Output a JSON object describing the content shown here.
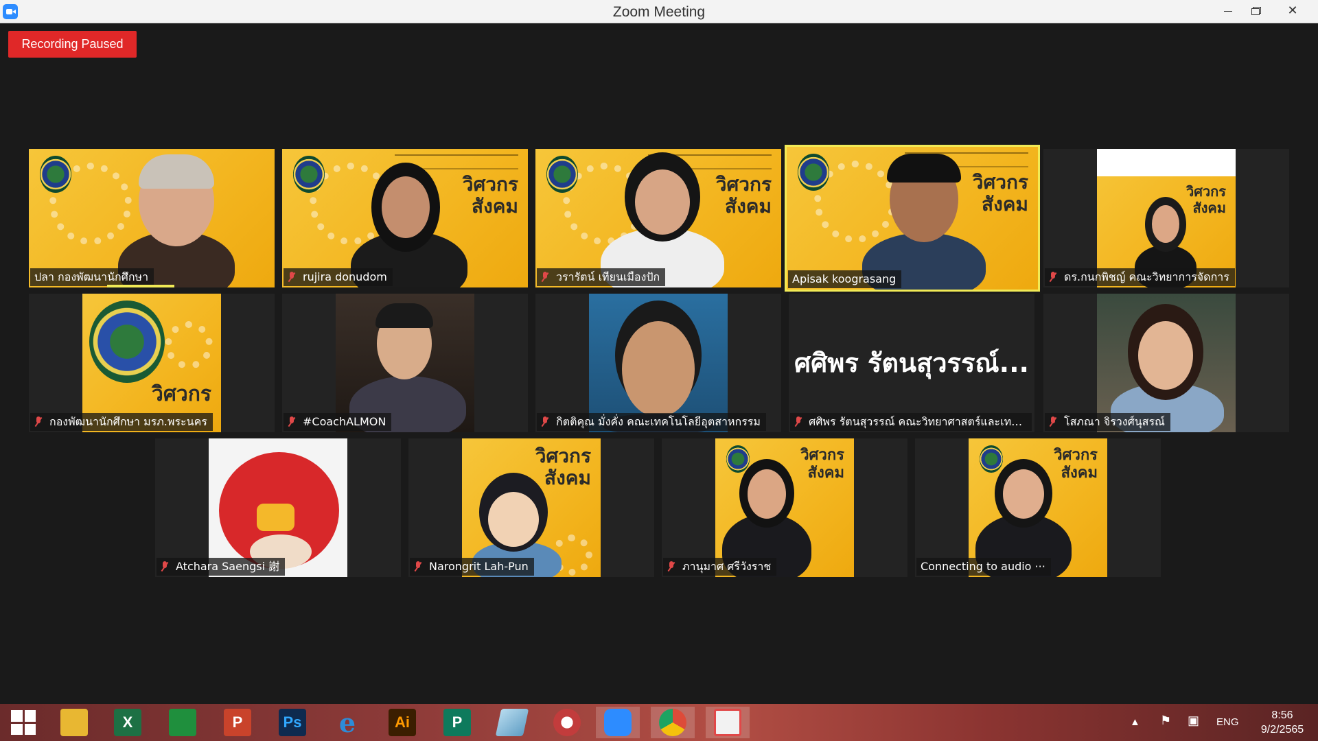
{
  "window": {
    "title": "Zoom Meeting",
    "minimize_symbol": "",
    "maximize_symbol": "",
    "close_symbol": "✕"
  },
  "recording_status": "Recording Paused",
  "banner_text": "วิศวกร\nสังคม",
  "participants": [
    {
      "name": "ปลา กองพัฒนานักศึกษา",
      "muted": false,
      "active": false,
      "speaking": true,
      "video": "camera"
    },
    {
      "name": "rujira donudom",
      "muted": true,
      "active": false,
      "speaking": false,
      "video": "camera"
    },
    {
      "name": "วรารัตน์ เทียนเมืองปัก",
      "muted": true,
      "active": false,
      "speaking": false,
      "video": "camera"
    },
    {
      "name": "Apisak koograsang",
      "muted": false,
      "active": true,
      "speaking": false,
      "video": "camera"
    },
    {
      "name": "ดร.กนกพิชญ์ คณะวิทยาการจัดการ",
      "muted": true,
      "active": false,
      "speaking": false,
      "video": "photo"
    },
    {
      "name": "กองพัฒนานักศึกษา มรภ.พระนคร",
      "muted": true,
      "active": false,
      "speaking": false,
      "video": "logo"
    },
    {
      "name": "#CoachALMON",
      "muted": true,
      "active": false,
      "speaking": false,
      "video": "photo"
    },
    {
      "name": "กิตติคุณ มั่งคั่ง คณะเทคโนโลยีอุตสาหกรรม",
      "muted": true,
      "active": false,
      "speaking": false,
      "video": "cartoon"
    },
    {
      "name": "ศศิพร รัตนสุวรรณ์ คณะวิทยาศาสตร์และเทคโน...",
      "muted": true,
      "active": false,
      "speaking": false,
      "video": "none",
      "display_name": "ศศิพร รัตนสุวรรณ์..."
    },
    {
      "name": "โสภณา จิรวงศ์นุสรณ์",
      "muted": true,
      "active": false,
      "speaking": false,
      "video": "photo"
    },
    {
      "name": "Atchara Saengsi 謝",
      "muted": true,
      "active": false,
      "speaking": false,
      "video": "bird"
    },
    {
      "name": "Narongrit Lah-Pun",
      "muted": true,
      "active": false,
      "speaking": false,
      "video": "anime"
    },
    {
      "name": "ภานุมาศ ศรีวังราช",
      "muted": true,
      "active": false,
      "speaking": false,
      "video": "photo"
    },
    {
      "name": "Connecting to audio ···",
      "muted": false,
      "active": false,
      "speaking": false,
      "video": "photo"
    }
  ],
  "taskbar": {
    "apps": [
      {
        "id": "start",
        "label": "",
        "color": "#ffffff"
      },
      {
        "id": "file-explorer",
        "label": "",
        "color": "#e8b732"
      },
      {
        "id": "excel",
        "label": "X",
        "color": "#1d7044"
      },
      {
        "id": "store",
        "label": "",
        "color": "#1f8f3d"
      },
      {
        "id": "powerpoint",
        "label": "P",
        "color": "#c9432b"
      },
      {
        "id": "photoshop",
        "label": "Ps",
        "color": "#0e2a4f"
      },
      {
        "id": "internet-explorer",
        "label": "e",
        "color": "#2d8cd8"
      },
      {
        "id": "illustrator",
        "label": "Ai",
        "color": "#3b1e00"
      },
      {
        "id": "publisher",
        "label": "P",
        "color": "#0e7a5c"
      },
      {
        "id": "notes",
        "label": "",
        "color": "#7fb6d8"
      },
      {
        "id": "photoscape",
        "label": "",
        "color": "#c23c3c"
      },
      {
        "id": "zoom",
        "label": "",
        "color": "#2d8cff"
      },
      {
        "id": "chrome",
        "label": "",
        "color": "#dd4b39"
      },
      {
        "id": "slideshow",
        "label": "",
        "color": "#e04848"
      }
    ],
    "tray": {
      "language": "ENG",
      "time": "8:56",
      "date": "9/2/2565"
    }
  },
  "colors": {
    "recording": "#e02828",
    "active_border": "#f1ea56",
    "banner_yellow": "#f3b51f",
    "muted_icon": "#e04848"
  }
}
